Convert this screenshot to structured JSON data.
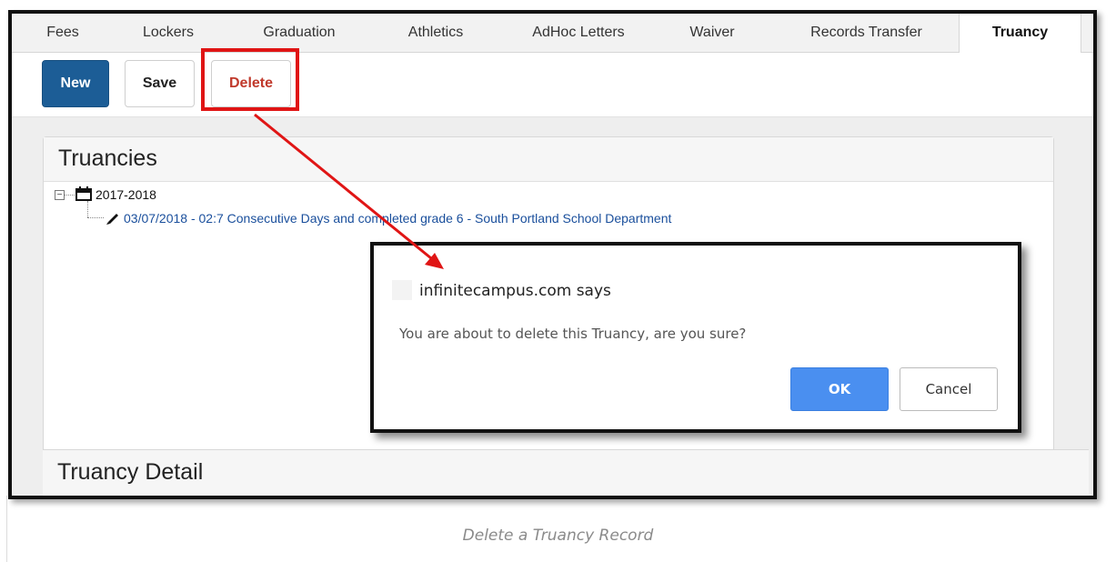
{
  "tabs": [
    {
      "label": "Fees",
      "active": false
    },
    {
      "label": "Lockers",
      "active": false
    },
    {
      "label": "Graduation",
      "active": false
    },
    {
      "label": "Athletics",
      "active": false
    },
    {
      "label": "AdHoc Letters",
      "active": false
    },
    {
      "label": "Waiver",
      "active": false
    },
    {
      "label": "Records Transfer",
      "active": false
    },
    {
      "label": "Truancy",
      "active": true
    }
  ],
  "toolbar": {
    "new_label": "New",
    "save_label": "Save",
    "delete_label": "Delete"
  },
  "truancies": {
    "title": "Truancies",
    "year": "2017-2018",
    "record": "03/07/2018 - 02:7 Consecutive Days and completed grade 6 - South Portland School Department"
  },
  "detail": {
    "title": "Truancy Detail"
  },
  "dialog": {
    "title": "infinitecampus.com says",
    "message": "You are about to delete this Truancy, are you sure?",
    "ok_label": "OK",
    "cancel_label": "Cancel"
  },
  "caption": "Delete a Truancy Record",
  "colors": {
    "primary_button": "#1c5d96",
    "delete_text": "#c0392b",
    "highlight": "#e01515",
    "ok_button": "#4a8ff0",
    "link": "#1a4f9c"
  },
  "icons": [
    "calendar-icon",
    "pencil-icon",
    "tree-collapse-icon"
  ]
}
